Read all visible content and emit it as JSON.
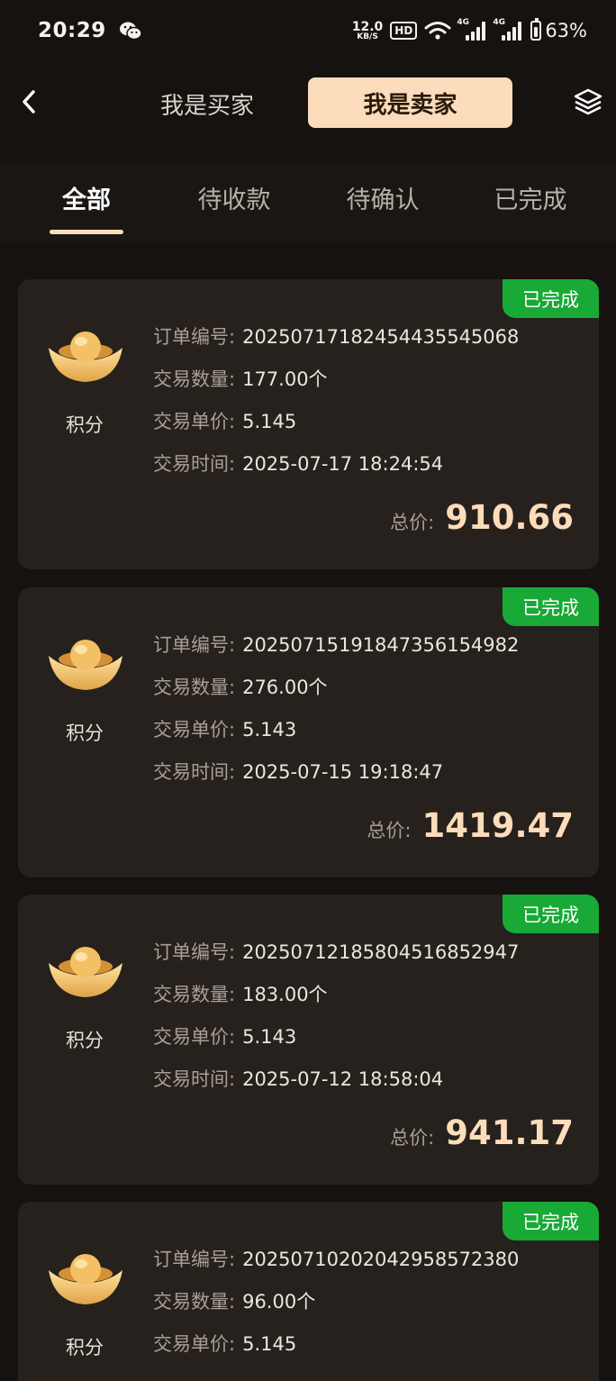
{
  "status": {
    "time": "20:29",
    "net_speed": "12.0",
    "net_unit": "KB/S",
    "hd": "HD",
    "sig1": "4G",
    "sig2": "4G",
    "battery": "63%"
  },
  "header": {
    "buyer_tab": "我是买家",
    "seller_tab": "我是卖家",
    "active": "seller"
  },
  "tabs": [
    "全部",
    "待收款",
    "待确认",
    "已完成"
  ],
  "labels": {
    "order_no": "订单编号:",
    "quantity": "交易数量:",
    "unit_price": "交易单价:",
    "time": "交易时间:",
    "total": "总价:"
  },
  "orders": [
    {
      "status": "已完成",
      "product": "积分",
      "order_no": "20250717182454435545068",
      "quantity": "177.00个",
      "unit_price": "5.145",
      "time": "2025-07-17 18:24:54",
      "total": "910.66"
    },
    {
      "status": "已完成",
      "product": "积分",
      "order_no": "20250715191847356154982",
      "quantity": "276.00个",
      "unit_price": "5.143",
      "time": "2025-07-15 19:18:47",
      "total": "1419.47"
    },
    {
      "status": "已完成",
      "product": "积分",
      "order_no": "20250712185804516852947",
      "quantity": "183.00个",
      "unit_price": "5.143",
      "time": "2025-07-12 18:58:04",
      "total": "941.17"
    },
    {
      "status": "已完成",
      "product": "积分",
      "order_no": "20250710202042958572380",
      "quantity": "96.00个",
      "unit_price": "5.145"
    }
  ],
  "colors": {
    "accent": "#fcdcba",
    "badge_green": "#19a937",
    "card_bg": "#26211d",
    "page_bg": "#151210"
  }
}
